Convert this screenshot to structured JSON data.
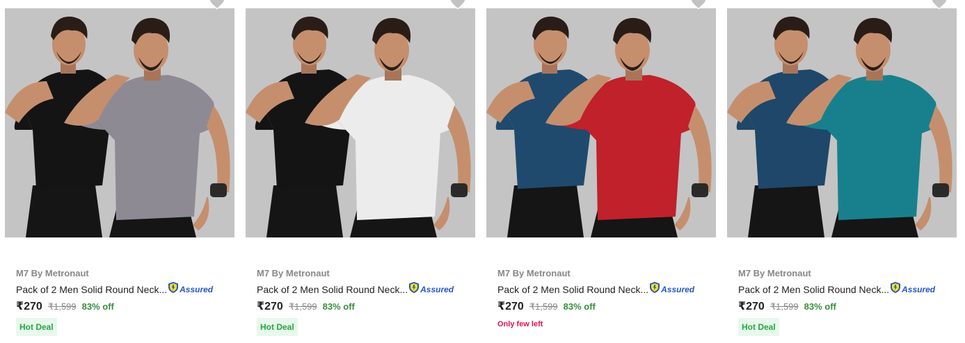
{
  "products": [
    {
      "brand": "M7 By Metronaut",
      "title": "Pack of 2 Men Solid Round Neck...",
      "assured": "Assured",
      "price": "₹270",
      "mrp": "₹1,599",
      "discount": "83% off",
      "tag": "Hot Deal",
      "tag_type": "hot",
      "shirt_back_color": "#141414",
      "shirt_front_color": "#8e8a94"
    },
    {
      "brand": "M7 By Metronaut",
      "title": "Pack of 2 Men Solid Round Neck...",
      "assured": "Assured",
      "price": "₹270",
      "mrp": "₹1,599",
      "discount": "83% off",
      "tag": "Hot Deal",
      "tag_type": "hot",
      "shirt_back_color": "#141414",
      "shirt_front_color": "#ececec"
    },
    {
      "brand": "M7 By Metronaut",
      "title": "Pack of 2 Men Solid Round Neck...",
      "assured": "Assured",
      "price": "₹270",
      "mrp": "₹1,599",
      "discount": "83% off",
      "tag": "Only few left",
      "tag_type": "few",
      "shirt_back_color": "#1f4a6e",
      "shirt_front_color": "#c0212b"
    },
    {
      "brand": "M7 By Metronaut",
      "title": "Pack of 2 Men Solid Round Neck...",
      "assured": "Assured",
      "price": "₹270",
      "mrp": "₹1,599",
      "discount": "83% off",
      "tag": "Hot Deal",
      "tag_type": "hot",
      "shirt_back_color": "#1e4769",
      "shirt_front_color": "#18808c"
    }
  ],
  "colors": {
    "photo_bg": "#c4c4c4",
    "brand": "#878787",
    "title": "#212121",
    "assured": "#2455c3",
    "discount": "#388e3c",
    "hot_deal_bg": "#e7f8ec",
    "hot_deal_text": "#26a541",
    "few_left_text": "#e1134e"
  },
  "icons": {
    "wishlist": "heart-icon",
    "assured": "assured-shield-icon"
  }
}
